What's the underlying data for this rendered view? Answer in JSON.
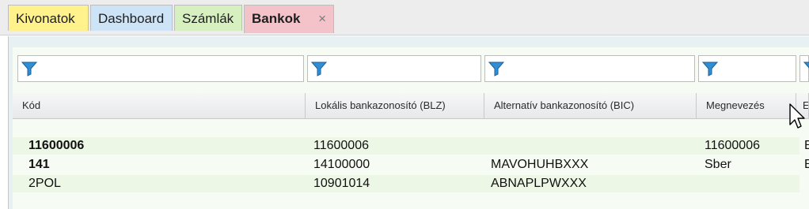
{
  "tabs": [
    {
      "label": "Kivonatok"
    },
    {
      "label": "Dashboard"
    },
    {
      "label": "Számlák"
    },
    {
      "label": "Bankok",
      "close": "×"
    }
  ],
  "columns": [
    {
      "label": "Kód"
    },
    {
      "label": "Lokális bankazonosító (BLZ)"
    },
    {
      "label": "Alternatív bankazonosító (BIC)"
    },
    {
      "label": "Megnevezés"
    },
    {
      "label": "E"
    }
  ],
  "rows": [
    {
      "kod": "11600006",
      "blz": "11600006",
      "bic": "",
      "name": "11600006",
      "extra": "E"
    },
    {
      "kod": "141",
      "blz": "14100000",
      "bic": "MAVOHUHBXXX",
      "name": "Sber",
      "extra": "E"
    },
    {
      "kod": "2POL",
      "blz": "10901014",
      "bic": "ABNAPLPWXXX",
      "name": "",
      "extra": ""
    }
  ],
  "colors": {
    "filter_icon": "#2f8fd6",
    "active_tab": "#f4c2c9"
  }
}
